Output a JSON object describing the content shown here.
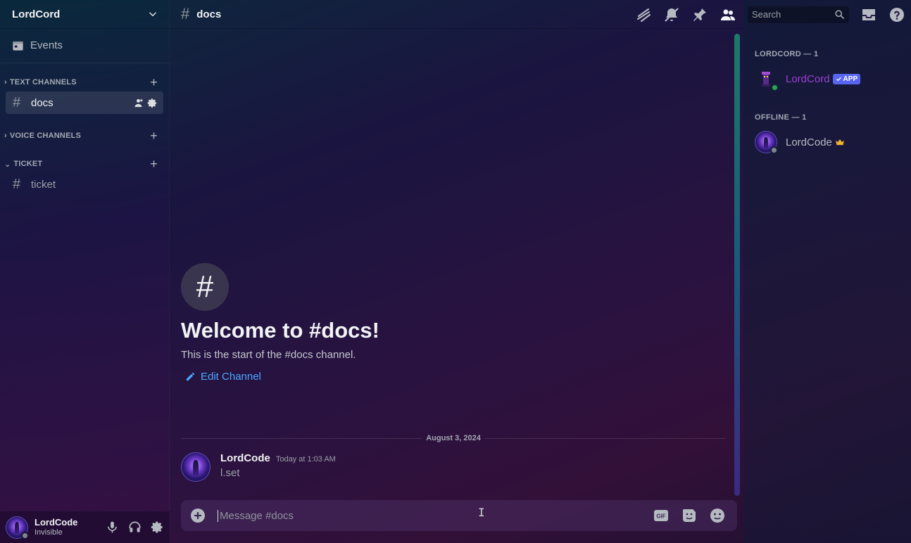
{
  "server": {
    "name": "LordCord"
  },
  "sidebar": {
    "events_label": "Events",
    "categories": [
      {
        "label": "TEXT CHANNELS"
      },
      {
        "label": "VOICE CHANNELS"
      },
      {
        "label": "TICKET"
      }
    ],
    "channels": {
      "docs": "docs",
      "ticket": "ticket"
    }
  },
  "user": {
    "name": "LordCode",
    "status": "Invisible"
  },
  "channel": {
    "name": "docs",
    "welcome_title": "Welcome to #docs!",
    "welcome_sub": "This is the start of the #docs channel.",
    "edit_label": "Edit Channel",
    "date_divider": "August 3, 2024"
  },
  "message": {
    "author": "LordCode",
    "time": "Today at 1:03 AM",
    "text": "l.set"
  },
  "composer": {
    "placeholder": "Message #docs"
  },
  "toolbar": {
    "search_placeholder": "Search"
  },
  "members": {
    "groups": [
      {
        "label": "LORDCORD — 1"
      },
      {
        "label": "OFFLINE — 1"
      }
    ],
    "bot": {
      "name": "LordCord",
      "badge": "APP",
      "name_color": "#9b3fd6"
    },
    "offline_member": {
      "name": "LordCode"
    }
  },
  "colors": {
    "accent": "#5865f2",
    "link": "#4aa8ff",
    "online": "#23a55a",
    "offline": "#80848e"
  },
  "composer_tools": [
    "gif-icon",
    "sticker-icon",
    "emoji-icon"
  ]
}
